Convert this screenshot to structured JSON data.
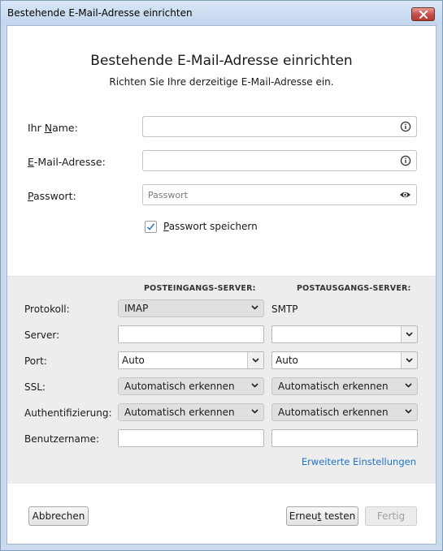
{
  "window": {
    "title": "Bestehende E-Mail-Adresse einrichten"
  },
  "header": {
    "heading": "Bestehende E-Mail-Adresse einrichten",
    "subheading": "Richten Sie Ihre derzeitige E-Mail-Adresse ein."
  },
  "account_form": {
    "name": {
      "label_pre": "Ihr ",
      "label_key": "N",
      "label_post": "ame:",
      "value": "",
      "icon": "info-icon"
    },
    "email": {
      "label_key": "E",
      "label_post": "-Mail-Adresse:",
      "value": "",
      "icon": "info-icon"
    },
    "password": {
      "label_key": "P",
      "label_post": "asswort:",
      "value": "",
      "placeholder": "Passwort",
      "icon": "eye-icon"
    },
    "remember": {
      "checked": true,
      "label_key": "P",
      "label_post": "asswort speichern"
    }
  },
  "server_panel": {
    "incoming_header": "POSTEINGANGS-SERVER:",
    "outgoing_header": "POSTAUSGANGS-SERVER:",
    "rows": {
      "protocol": {
        "label": "Protokoll:",
        "incoming": "IMAP",
        "outgoing": "SMTP"
      },
      "server": {
        "label": "Server:",
        "incoming": "",
        "outgoing": ""
      },
      "port": {
        "label": "Port:",
        "incoming": "Auto",
        "outgoing": "Auto"
      },
      "ssl": {
        "label": "SSL:",
        "incoming": "Automatisch erkennen",
        "outgoing": "Automatisch erkennen"
      },
      "auth": {
        "label": "Authentifizierung:",
        "incoming": "Automatisch erkennen",
        "outgoing": "Automatisch erkennen"
      },
      "username": {
        "label": "Benutzername:",
        "incoming": "",
        "outgoing": ""
      }
    },
    "advanced_link": "Erweiterte Einstellungen"
  },
  "footer": {
    "cancel_label": "Abbrechen",
    "retest_pre": "Erneu",
    "retest_key": "t",
    "retest_post": " testen",
    "done_label": "Fertig",
    "done_enabled": false
  },
  "colors": {
    "link": "#1e73c8",
    "panel": "#ededed",
    "dropdown": "#e0e0e0",
    "close_button": "#c75050"
  }
}
